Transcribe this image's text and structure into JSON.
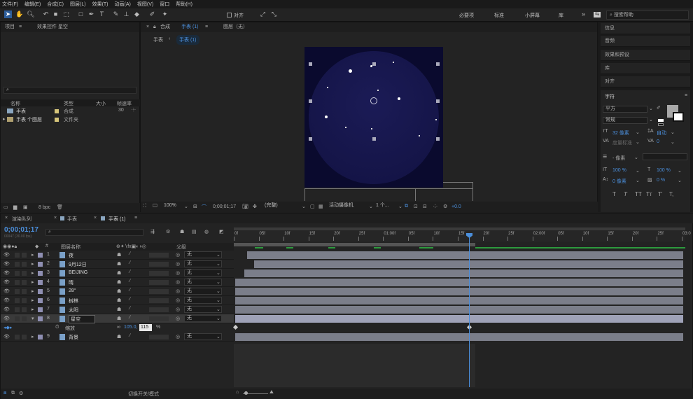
{
  "menu": [
    "文件(F)",
    "编辑(E)",
    "合成(C)",
    "图层(L)",
    "效果(T)",
    "动画(A)",
    "视图(V)",
    "窗口",
    "帮助(H)"
  ],
  "toolbar": {
    "align_label": "对齐",
    "workspaces": [
      "必要项",
      "标准",
      "小屏幕",
      "库"
    ],
    "search_placeholder": "搜索帮助"
  },
  "project": {
    "tab": "项目",
    "effects_tab": "效果控件 星空",
    "search_icon": "search-icon",
    "headers": [
      "名称",
      "类型",
      "大小",
      "帧速率"
    ],
    "items": [
      {
        "name": "手表",
        "type": "合成",
        "rate": "30"
      },
      {
        "name": "手表 个图层",
        "type": "文件夹",
        "rate": ""
      }
    ],
    "bpc": "8 bpc"
  },
  "comp": {
    "tab_prefix": "合成",
    "tab_name": "手表 (1)",
    "layer_tab": "图层（无）",
    "crumbs": [
      "手表",
      "手表 (1)"
    ],
    "zoom": "100%",
    "time": "0;00;01;17",
    "quality": "(完整)",
    "camera": "活动摄像机",
    "views": "1 个...",
    "exposure": "+0.0",
    "bg_color": "#0a0a2e",
    "circle_color": "#16164a"
  },
  "timeline": {
    "tabs": [
      "渲染队列",
      "手表",
      "手表 (1)"
    ],
    "time": "0;00;01;17",
    "subtime": "00047 (30.00 fps)",
    "col_headers": [
      "#",
      "图层名称",
      "父级"
    ],
    "ruler": [
      "0f",
      "05f",
      "10f",
      "15f",
      "20f",
      "25f",
      "01:00f",
      "05f",
      "10f",
      "15f",
      "20f",
      "25f",
      "02:00f",
      "05f",
      "10f",
      "15f",
      "20f",
      "25f",
      "03:0"
    ],
    "layers": [
      {
        "n": "1",
        "name": "夜",
        "parent": "无"
      },
      {
        "n": "2",
        "name": "9月12日",
        "parent": "无"
      },
      {
        "n": "3",
        "name": "BEIJING",
        "parent": "无"
      },
      {
        "n": "4",
        "name": "晴",
        "parent": "无"
      },
      {
        "n": "5",
        "name": "28°",
        "parent": "无"
      },
      {
        "n": "6",
        "name": "树林",
        "parent": "无"
      },
      {
        "n": "7",
        "name": "太阳",
        "parent": "无"
      },
      {
        "n": "8",
        "name": "星空",
        "parent": "无"
      },
      {
        "n": "9",
        "name": "背景",
        "parent": "无"
      }
    ],
    "scale": {
      "label": "缩放",
      "value": "105.0,",
      "value2": "115",
      "unit": "%"
    },
    "footer": "切换开关/模式"
  },
  "right": {
    "sections": [
      "信息",
      "音频",
      "效果和预设",
      "库",
      "对齐"
    ],
    "char_title": "字符",
    "font": "平方",
    "style": "常规",
    "size": "32 像素",
    "leading": "自动",
    "tracking": "度量标准",
    "kern": "0",
    "stroke": "- 像素",
    "vscale": "100 %",
    "hscale": "100 %",
    "baseline": "0 像素",
    "tsume": "0 %",
    "glyphs": [
      "T",
      "T",
      "TT",
      "Tт",
      "T'",
      "T,"
    ]
  }
}
